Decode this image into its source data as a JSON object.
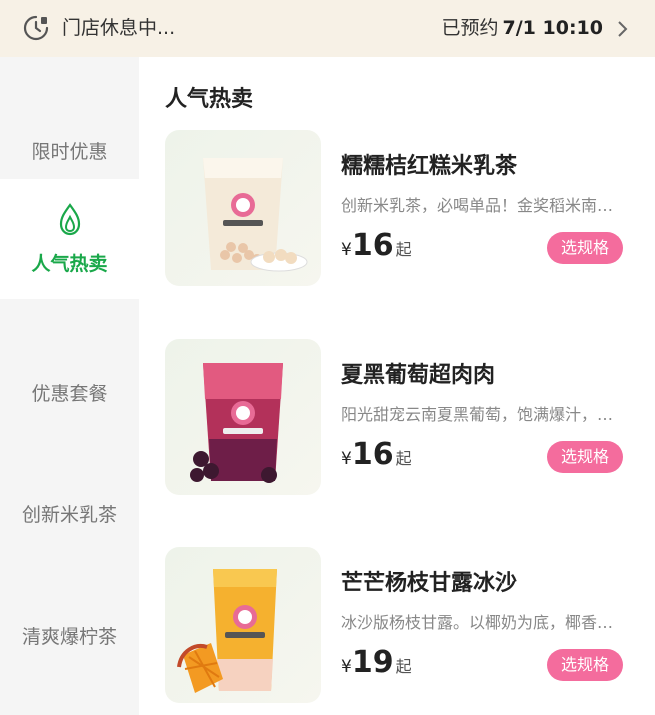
{
  "topbar": {
    "status": "门店休息中...",
    "reserve_label": "已预约",
    "reserve_time": "7/1 10:10",
    "icons": {
      "clock": "clock-icon",
      "chevron": "chevron-right-icon"
    }
  },
  "sidebar": {
    "items": [
      {
        "label": "限时优惠",
        "active": false
      },
      {
        "label": "人气热卖",
        "active": true,
        "icon": "leaf-icon"
      },
      {
        "label": "优惠套餐",
        "active": false
      },
      {
        "label": "创新米乳茶",
        "active": false
      },
      {
        "label": "清爽爆柠茶",
        "active": false
      }
    ]
  },
  "main": {
    "section_title": "人气热卖",
    "products": [
      {
        "name": "糯糯桔红糕米乳茶",
        "desc": "创新米乳茶，必喝单品！金奖稻米南…",
        "currency": "¥",
        "price": "16",
        "suffix": "起",
        "button": "选规格",
        "image": "milk-tea-image"
      },
      {
        "name": "夏黑葡萄超肉肉",
        "desc": "阳光甜宠云南夏黑葡萄，饱满爆汁，…",
        "currency": "¥",
        "price": "16",
        "suffix": "起",
        "button": "选规格",
        "image": "grape-drink-image"
      },
      {
        "name": "芒芒杨枝甘露冰沙",
        "desc": "冰沙版杨枝甘露。以椰奶为底，椰香…",
        "currency": "¥",
        "price": "19",
        "suffix": "起",
        "button": "选规格",
        "image": "mango-smoothie-image"
      }
    ]
  },
  "colors": {
    "accent_green": "#1aa84a",
    "button_pink": "#f46c9d",
    "topbar_bg": "#f7f1e6",
    "sidebar_bg": "#f5f5f5"
  }
}
